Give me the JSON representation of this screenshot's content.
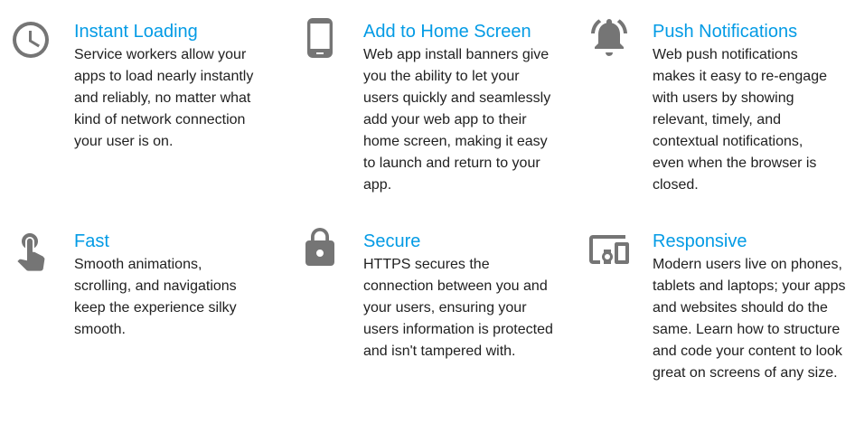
{
  "features": [
    {
      "title": "Instant Loading",
      "icon": "clock-icon",
      "body": "Service workers allow your apps to load nearly instantly and reliably, no matter what kind of network connection your user is on."
    },
    {
      "title": "Add to Home Screen",
      "icon": "phone-icon",
      "body": "Web app install banners give you the ability to let your users quickly and seamlessly add your web app to their home screen, making it easy to launch and return to your app."
    },
    {
      "title": "Push Notifications",
      "icon": "bell-icon",
      "body": "Web push notifications makes it easy to re-engage with users by showing relevant, timely, and contextual notifications, even when the browser is closed."
    },
    {
      "title": "Fast",
      "icon": "touch-icon",
      "body": "Smooth animations, scrolling, and navigations keep the experience silky smooth."
    },
    {
      "title": "Secure",
      "icon": "lock-icon",
      "body": "HTTPS secures the connection between you and your users, ensuring your users information is protected and isn't tampered with."
    },
    {
      "title": "Responsive",
      "icon": "devices-icon",
      "body": "Modern users live on phones, tablets and laptops; your apps and websites should do the same. Learn how to structure and code your content to look great on screens of any size."
    }
  ]
}
